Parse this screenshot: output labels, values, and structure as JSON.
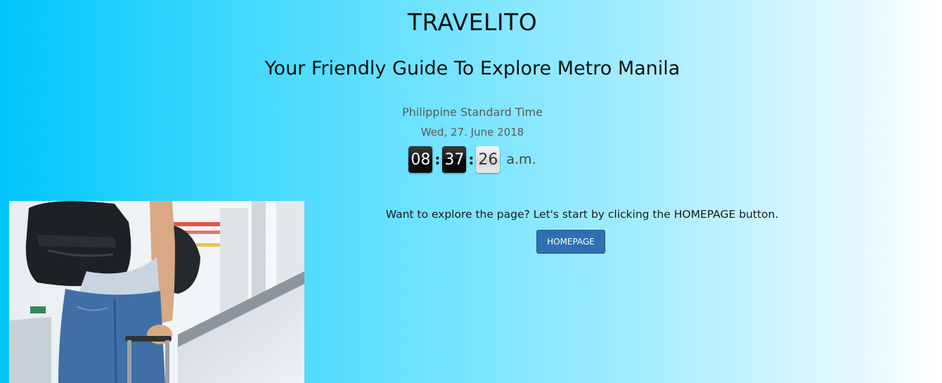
{
  "header": {
    "title": "TRAVELITO",
    "tagline": "Your Friendly Guide To Explore Metro Manila"
  },
  "clock": {
    "timezone_label": "Philippine Standard Time",
    "date": "Wed, 27. June 2018",
    "hours": "08",
    "minutes": "37",
    "seconds": "26",
    "separator": ":",
    "period": "a.m."
  },
  "cta": {
    "text": "Want to explore the page? Let's start by clicking the HOMEPAGE button.",
    "button_label": "HOMEPAGE"
  },
  "colors": {
    "gradient_start": "#00c6fb",
    "gradient_end": "#ffffff",
    "button": "#2f6fb3"
  }
}
